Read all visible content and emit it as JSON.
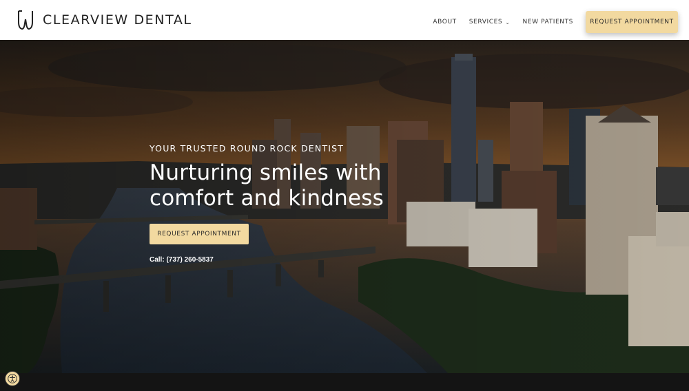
{
  "brand": {
    "name": "CLEARVIEW DENTAL",
    "logo_icon": "tooth-outline-icon"
  },
  "nav": {
    "items": [
      {
        "label": "ABOUT"
      },
      {
        "label": "SERVICES",
        "has_dropdown": true
      },
      {
        "label": "NEW PATIENTS"
      }
    ],
    "cta_label": "REQUEST APPOINTMENT"
  },
  "hero": {
    "eyebrow": "YOUR TRUSTED ROUND ROCK DENTIST",
    "headline_line1": "Nurturing smiles with",
    "headline_line2": "comfort and kindness",
    "cta_label": "REQUEST APPOINTMENT",
    "phone_text": "Call: (737) 260-5837",
    "background": "city-skyline-river-sunset-photo"
  },
  "accessibility": {
    "icon": "accessibility-icon"
  },
  "colors": {
    "accent": "#f2d9a0",
    "header_bg": "#ffffff",
    "text_dark": "#222222"
  }
}
